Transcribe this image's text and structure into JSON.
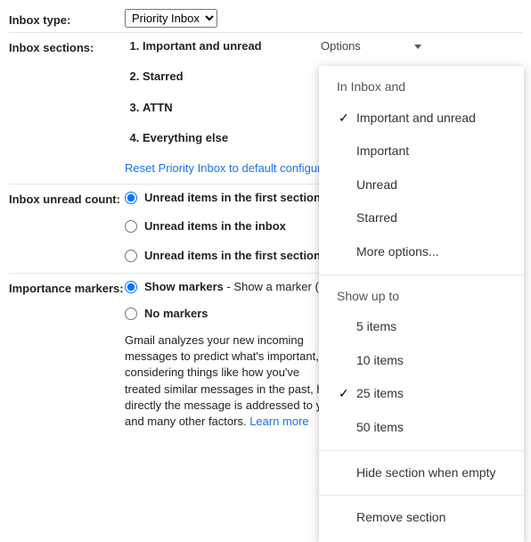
{
  "rows": {
    "inbox_type_label": "Inbox type:",
    "inbox_sections_label": "Inbox sections:",
    "unread_count_label": "Inbox unread count:",
    "importance_label": "Importance markers:"
  },
  "inbox_type_selected": "Priority Inbox",
  "sections": {
    "items": [
      "Important and unread",
      "Starred",
      "ATTN",
      "Everything else"
    ],
    "reset_link": "Reset Priority Inbox to default configuration",
    "options_button": "Options"
  },
  "dropdown": {
    "group1_header": "In Inbox and",
    "filters": [
      {
        "label": "Important and unread",
        "checked": true
      },
      {
        "label": "Important",
        "checked": false
      },
      {
        "label": "Unread",
        "checked": false
      },
      {
        "label": "Starred",
        "checked": false
      },
      {
        "label": "More options...",
        "checked": false
      }
    ],
    "group2_header": "Show up to",
    "counts": [
      {
        "label": "5 items",
        "checked": false
      },
      {
        "label": "10 items",
        "checked": false
      },
      {
        "label": "25 items",
        "checked": true
      },
      {
        "label": "50 items",
        "checked": false
      }
    ],
    "hide_empty": "Hide section when empty",
    "remove_section": "Remove section"
  },
  "unread_count": {
    "options": [
      "Unread items in the first section",
      "Unread items in the inbox",
      "Unread items in the first section and inbox"
    ],
    "selected_index": 0
  },
  "importance": {
    "show_label": "Show markers",
    "show_suffix": " - Show a marker (",
    "show_suffix_end": ")",
    "no_label": "No markers",
    "selected_index": 0,
    "explain": "Gmail analyzes your new incoming messages to predict what's important, considering things like how you've treated similar messages in the past, how directly the message is addressed to you, and many other factors. ",
    "learn_more": "Learn more"
  }
}
